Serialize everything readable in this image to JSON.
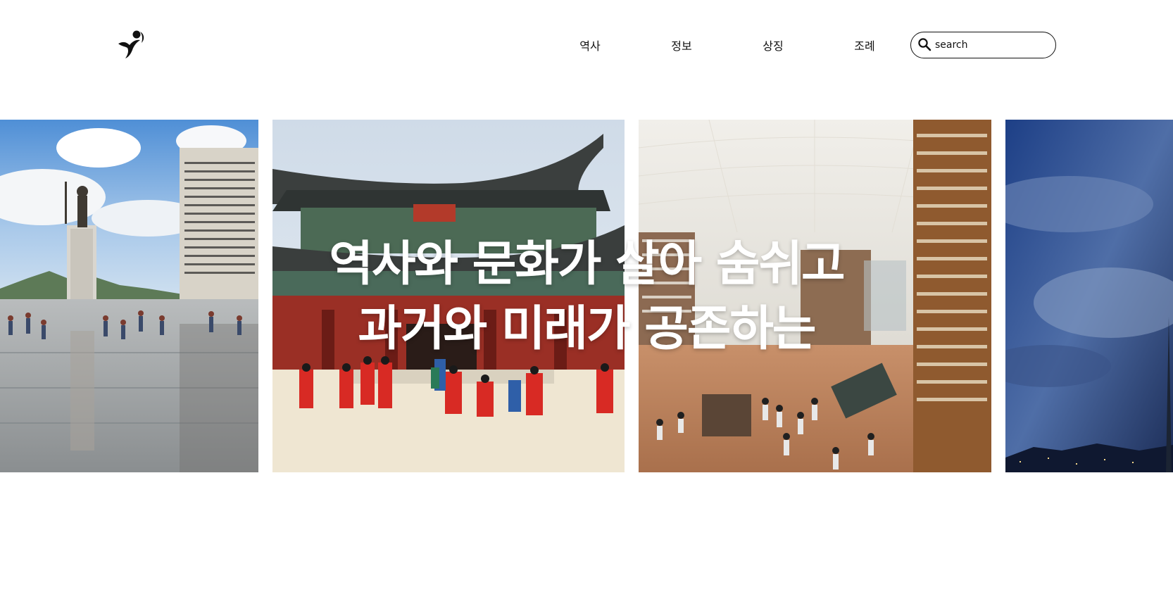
{
  "nav": {
    "items": [
      {
        "label": "역사"
      },
      {
        "label": "정보"
      },
      {
        "label": "상징"
      },
      {
        "label": "조례"
      }
    ]
  },
  "search": {
    "placeholder": "search",
    "icon": "search-icon"
  },
  "hero": {
    "line1": "역사와 문화가 살아 숨쉬고",
    "line2": "과거와 미래가 공존하는"
  },
  "slides": [
    {
      "icon": "gwanghwamun-square-statue"
    },
    {
      "icon": "gyeongbokgung-gate-guard-ceremony"
    },
    {
      "icon": "starfield-library"
    },
    {
      "icon": "seoul-night-sky-tower"
    }
  ]
}
